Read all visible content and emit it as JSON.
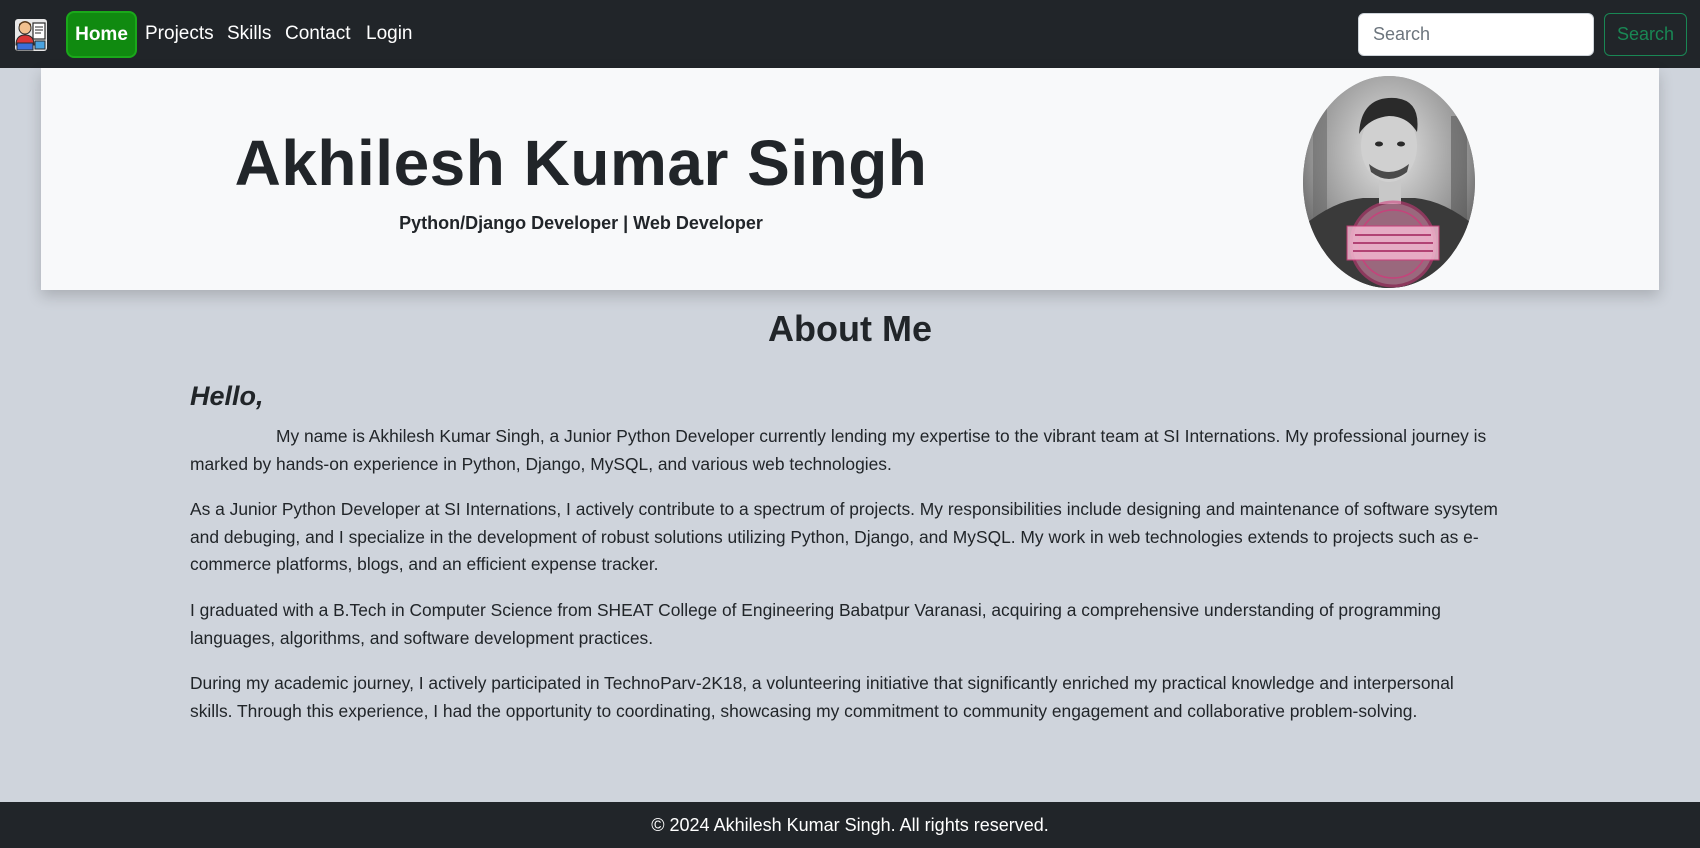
{
  "nav": {
    "home": "Home",
    "projects": "Projects",
    "skills": "Skills",
    "contact": "Contact",
    "login": "Login",
    "search_placeholder": "Search",
    "search_button": "Search"
  },
  "hero": {
    "name": "Akhilesh Kumar Singh",
    "subtitle": "Python/Django Developer | Web Developer",
    "avatar_stamp": "Always stay true to yourself & never sacrifice who are you for anyone."
  },
  "about": {
    "title": "About Me",
    "greeting": "Hello,",
    "paragraphs": [
      "My name is Akhilesh Kumar Singh, a Junior Python Developer currently lending my expertise to the vibrant team at SI Internations. My professional journey is marked by hands-on experience in Python, Django, MySQL, and various web technologies.",
      "As a Junior Python Developer at SI Internations, I actively contribute to a spectrum of projects. My responsibilities include designing and maintenance of software sysytem and debuging, and I specialize in the development of robust solutions utilizing Python, Django, and MySQL. My work in web technologies extends to projects such as e-commerce platforms, blogs, and an efficient expense tracker.",
      "I graduated with a B.Tech in Computer Science from SHEAT College of Engineering Babatpur Varanasi, acquiring a comprehensive understanding of programming languages, algorithms, and software development practices.",
      "During my academic journey, I actively participated in TechnoParv-2K18, a volunteering initiative that significantly enriched my practical knowledge and interpersonal skills. Through this experience, I had the opportunity to coordinating, showcasing my commitment to community engagement and collaborative problem-solving."
    ]
  },
  "footer": {
    "text": "© 2024 Akhilesh Kumar Singh. All rights reserved."
  },
  "colors": {
    "navbar_bg": "#212529",
    "active_nav_bg": "#108a10",
    "search_button_accent": "#198754",
    "page_bg": "#cfd4dc",
    "hero_bg": "#f8f9fa"
  },
  "icons": {
    "brand": "developer-avatar-icon"
  }
}
